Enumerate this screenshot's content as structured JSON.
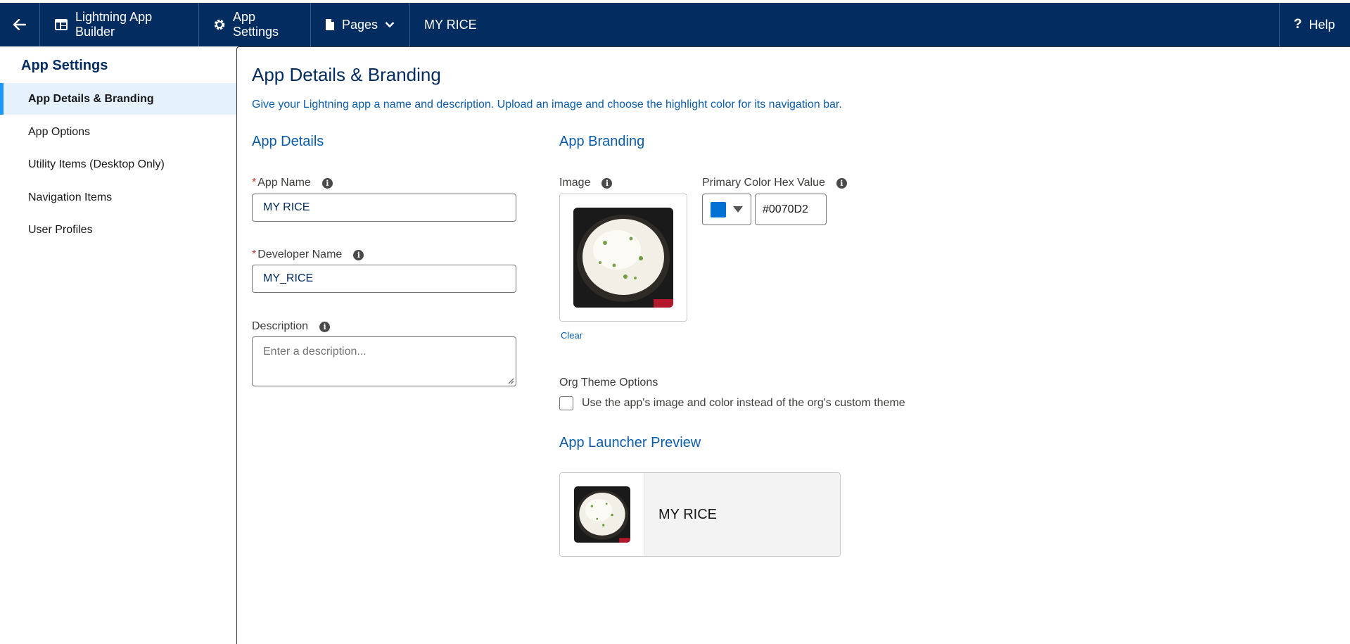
{
  "topbar": {
    "back_icon": "arrow-left-icon",
    "builder_label": "Lightning App Builder",
    "settings_label": "App Settings",
    "pages_label": "Pages",
    "app_name": "MY RICE",
    "help_label": "Help",
    "bg_color": "#032d60"
  },
  "sidebar": {
    "title": "App Settings",
    "items": [
      {
        "label": "App Details & Branding",
        "active": true
      },
      {
        "label": "App Options",
        "active": false
      },
      {
        "label": "Utility Items (Desktop Only)",
        "active": false
      },
      {
        "label": "Navigation Items",
        "active": false
      },
      {
        "label": "User Profiles",
        "active": false
      }
    ]
  },
  "main": {
    "title": "App Details & Branding",
    "description": "Give your Lightning app a name and description. Upload an image and choose the highlight color for its navigation bar.",
    "details": {
      "section_title": "App Details",
      "app_name_label": "App Name",
      "app_name_value": "MY RICE",
      "developer_name_label": "Developer Name",
      "developer_name_value": "MY_RICE",
      "description_label": "Description",
      "description_placeholder": "Enter a description...",
      "required_mark": "*"
    },
    "branding": {
      "section_title": "App Branding",
      "image_label": "Image",
      "clear_label": "Clear",
      "color_label": "Primary Color Hex Value",
      "color_value": "#0070D2",
      "swatch_color": "#0070d2",
      "org_theme_label": "Org Theme Options",
      "org_theme_checkbox_label": "Use the app's image and color instead of the org's custom theme",
      "org_theme_checked": false
    },
    "preview": {
      "section_title": "App Launcher Preview",
      "app_name": "MY RICE"
    }
  }
}
